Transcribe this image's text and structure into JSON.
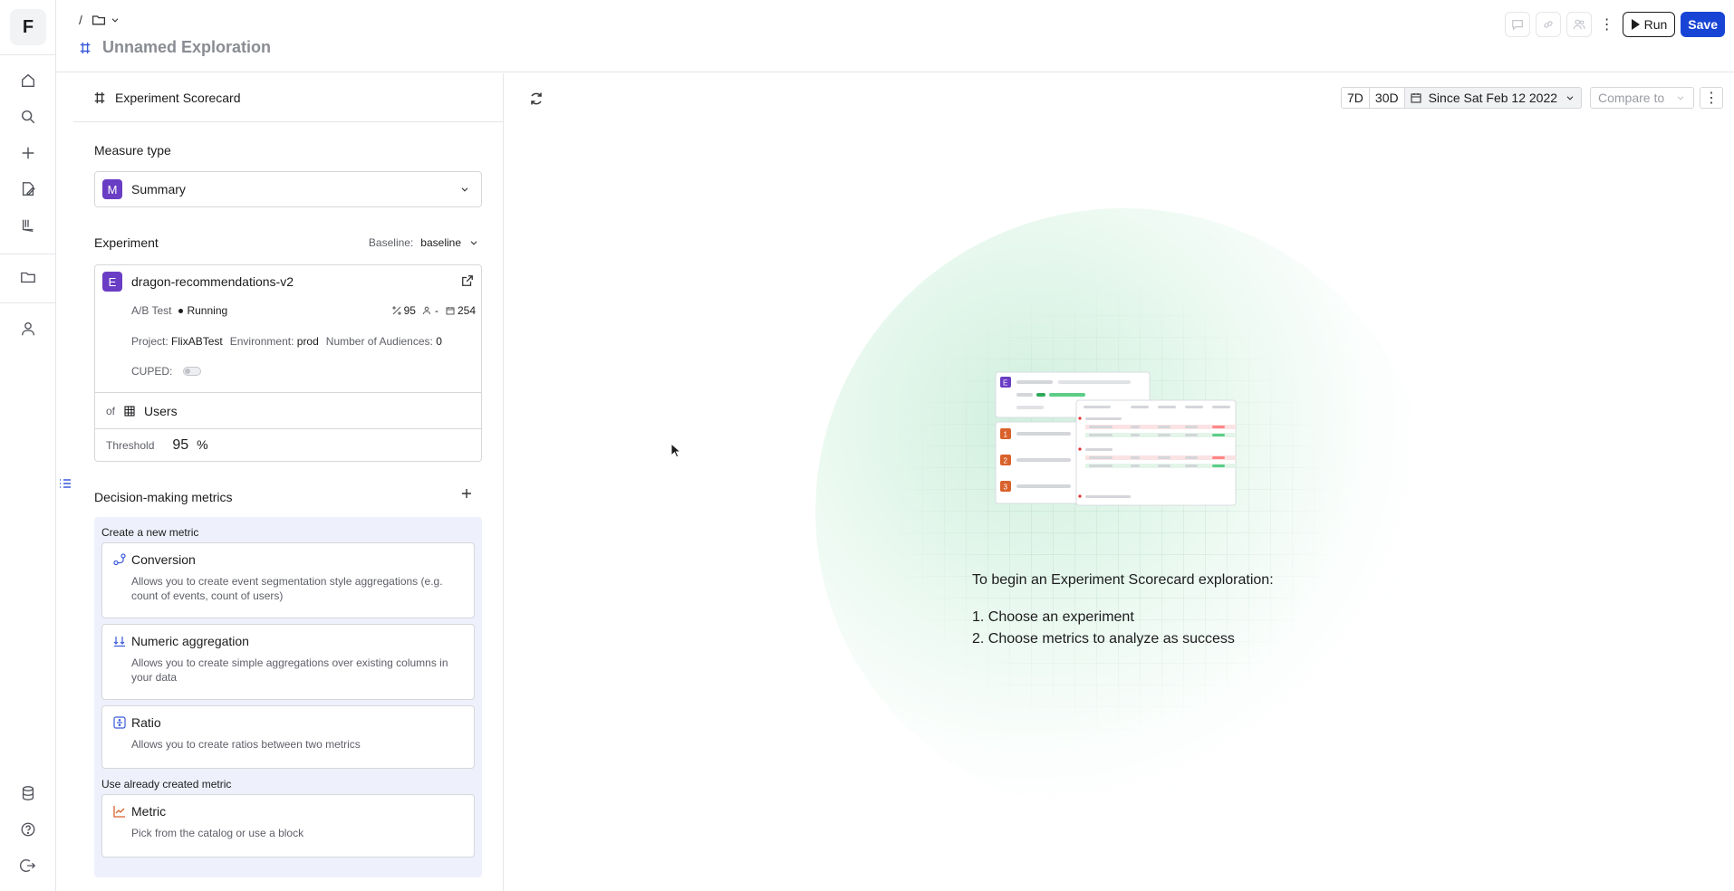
{
  "app": {
    "logo_letter": "F"
  },
  "header": {
    "breadcrumb_sep": "/",
    "title": "Unnamed Exploration",
    "run_label": "Run",
    "save_label": "Save"
  },
  "panel": {
    "heading": "Experiment Scorecard",
    "measure_type_label": "Measure type",
    "measure_type_badge": "M",
    "measure_type_value": "Summary",
    "experiment_label": "Experiment",
    "baseline_label": "Baseline:",
    "baseline_value": "baseline",
    "experiment": {
      "badge": "E",
      "name": "dragon-recommendations-v2",
      "type": "A/B Test",
      "status": "Running",
      "stat_confidence": "95",
      "stat_users": "-",
      "stat_days": "254",
      "project_label": "Project:",
      "project_value": "FlixABTest",
      "environment_label": "Environment:",
      "environment_value": "prod",
      "audiences_label": "Number of Audiences:",
      "audiences_value": "0",
      "cuped_label": "CUPED:"
    },
    "of_label": "of",
    "of_value": "Users",
    "threshold_label": "Threshold",
    "threshold_value": "95",
    "threshold_unit": "%",
    "metrics_heading": "Decision-making metrics",
    "create_new_label": "Create a new metric",
    "metric_types": [
      {
        "title": "Conversion",
        "desc": "Allows you to create event segmentation style aggregations (e.g. count of events, count of users)"
      },
      {
        "title": "Numeric aggregation",
        "desc": "Allows you to create simple aggregations over existing columns in your data"
      },
      {
        "title": "Ratio",
        "desc": "Allows you to create ratios between two metrics"
      }
    ],
    "use_existing_label": "Use already created metric",
    "existing": {
      "title": "Metric",
      "desc": "Pick from the catalog or use a block"
    }
  },
  "main": {
    "range_7d": "7D",
    "range_30d": "30D",
    "date_range": "Since Sat Feb 12 2022",
    "compare_placeholder": "Compare to",
    "instructions_title": "To begin an Experiment Scorecard exploration:",
    "steps": [
      "1. Choose an experiment",
      "2. Choose metrics to analyze as success"
    ]
  },
  "colors": {
    "accent": "#1844d6",
    "badge_purple": "#6a3ec4",
    "illus_orange": "#d9622b",
    "illus_green": "#2fa85a"
  },
  "icons": [
    "home-icon",
    "search-icon",
    "plus-icon",
    "edit-doc-icon",
    "experiment-icon",
    "folder-icon",
    "user-icon",
    "database-icon",
    "help-icon",
    "logout-icon"
  ]
}
